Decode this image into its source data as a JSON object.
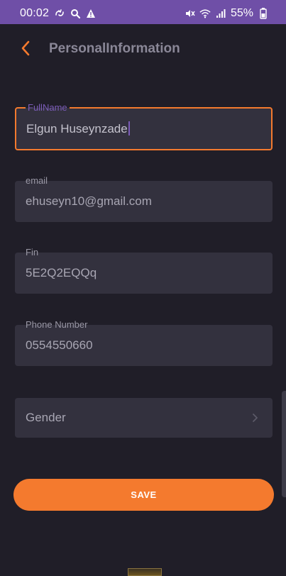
{
  "status_bar": {
    "time": "00:02",
    "battery": "55%",
    "left_icons": [
      "sync-icon",
      "search-icon",
      "warning-icon"
    ],
    "right_icons": [
      "mute-icon",
      "wifi-icon",
      "signal-icon",
      "battery-icon"
    ],
    "color": "#6f4fa7"
  },
  "header": {
    "title": "PersonalInformation",
    "back_icon": "chevron-left-icon"
  },
  "fields": [
    {
      "label": "FullName",
      "value": "Elgun Huseynzade",
      "focused": true
    },
    {
      "label": "email",
      "value": "ehuseyn10@gmail.com"
    },
    {
      "label": "Fin",
      "value": "5E2Q2EQQq"
    },
    {
      "label": "Phone Number",
      "value": "0554550660"
    }
  ],
  "gender": {
    "label": "Gender",
    "icon": "chevron-right-icon"
  },
  "save_button": {
    "label": "SAVE"
  },
  "colors": {
    "background": "#201e28",
    "field_bg": "#33313e",
    "accent": "#f47a2e",
    "focus_label": "#7b5cb8"
  }
}
